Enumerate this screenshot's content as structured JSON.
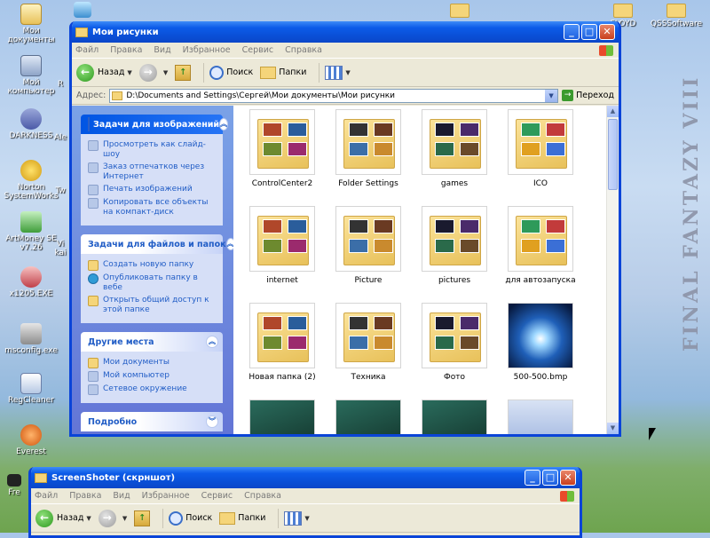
{
  "desktop": {
    "wallpaper_text": "FINAL FANTAZY VIII",
    "icons": [
      {
        "label": "Мои документы",
        "icon": "my-documents-icon"
      },
      {
        "label": "Мой компьютер",
        "icon": "my-computer-icon"
      },
      {
        "label": "DARKNESS",
        "icon": "darkness-icon"
      },
      {
        "label": "Norton SystemWorks",
        "icon": "norton-icon"
      },
      {
        "label": "ArtMoney SE v7.26",
        "icon": "artmoney-icon"
      },
      {
        "label": "x1205.EXE",
        "icon": "exe-icon"
      },
      {
        "label": "msconfig.exe",
        "icon": "msconfig-icon"
      },
      {
        "label": "RegCleaner",
        "icon": "regcleaner-icon"
      },
      {
        "label": "Everest",
        "icon": "everest-icon"
      },
      {
        "label": "Fre",
        "icon": "app-icon"
      }
    ],
    "partial_labels": [
      "R",
      "Ale",
      "Tw",
      "Vi\nkai"
    ],
    "top_folders": [
      {
        "label": ""
      },
      {
        "label": "FLOYD"
      },
      {
        "label": "QSSSoftware"
      }
    ]
  },
  "main_window": {
    "title": "Мои рисунки",
    "menu": [
      "Файл",
      "Правка",
      "Вид",
      "Избранное",
      "Сервис",
      "Справка"
    ],
    "toolbar": {
      "back": "Назад",
      "search": "Поиск",
      "folders": "Папки"
    },
    "address": {
      "label": "Адрес:",
      "value": "D:\\Documents and Settings\\Сергей\\Мои документы\\Мои рисунки",
      "go": "Переход"
    },
    "panels": [
      {
        "title": "Задачи для изображений",
        "items": [
          "Просмотреть как слайд-шоу",
          "Заказ отпечатков через Интернет",
          "Печать изображений",
          "Копировать все объекты на компакт-диск"
        ]
      },
      {
        "title": "Задачи для файлов и папок",
        "items": [
          "Создать новую папку",
          "Опубликовать папку в вебе",
          "Открыть общий доступ к этой папке"
        ]
      },
      {
        "title": "Другие места",
        "items": [
          "Мои документы",
          "Мой компьютер",
          "Сетевое окружение"
        ]
      },
      {
        "title": "Подробно",
        "items": []
      }
    ],
    "files": [
      {
        "name": "ControlCenter2"
      },
      {
        "name": "Folder Settings"
      },
      {
        "name": "games"
      },
      {
        "name": "ICO"
      },
      {
        "name": "internet"
      },
      {
        "name": "Picture"
      },
      {
        "name": "pictures"
      },
      {
        "name": "для автозапуска"
      },
      {
        "name": "Новая папка (2)"
      },
      {
        "name": "Техника"
      },
      {
        "name": "Фото"
      },
      {
        "name": "500-500.bmp"
      },
      {
        "name": ""
      },
      {
        "name": ""
      },
      {
        "name": ""
      },
      {
        "name": ""
      }
    ]
  },
  "second_window": {
    "title": "ScreenShoter (скрншот)",
    "menu": [
      "Файл",
      "Правка",
      "Вид",
      "Избранное",
      "Сервис",
      "Справка"
    ],
    "toolbar": {
      "back": "Назад",
      "search": "Поиск",
      "folders": "Папки"
    }
  },
  "colors": {
    "titlebar": "#0a4fd6",
    "task_pane": "#6f8fe0",
    "link": "#215dc6",
    "folder": "#f5d57a"
  }
}
